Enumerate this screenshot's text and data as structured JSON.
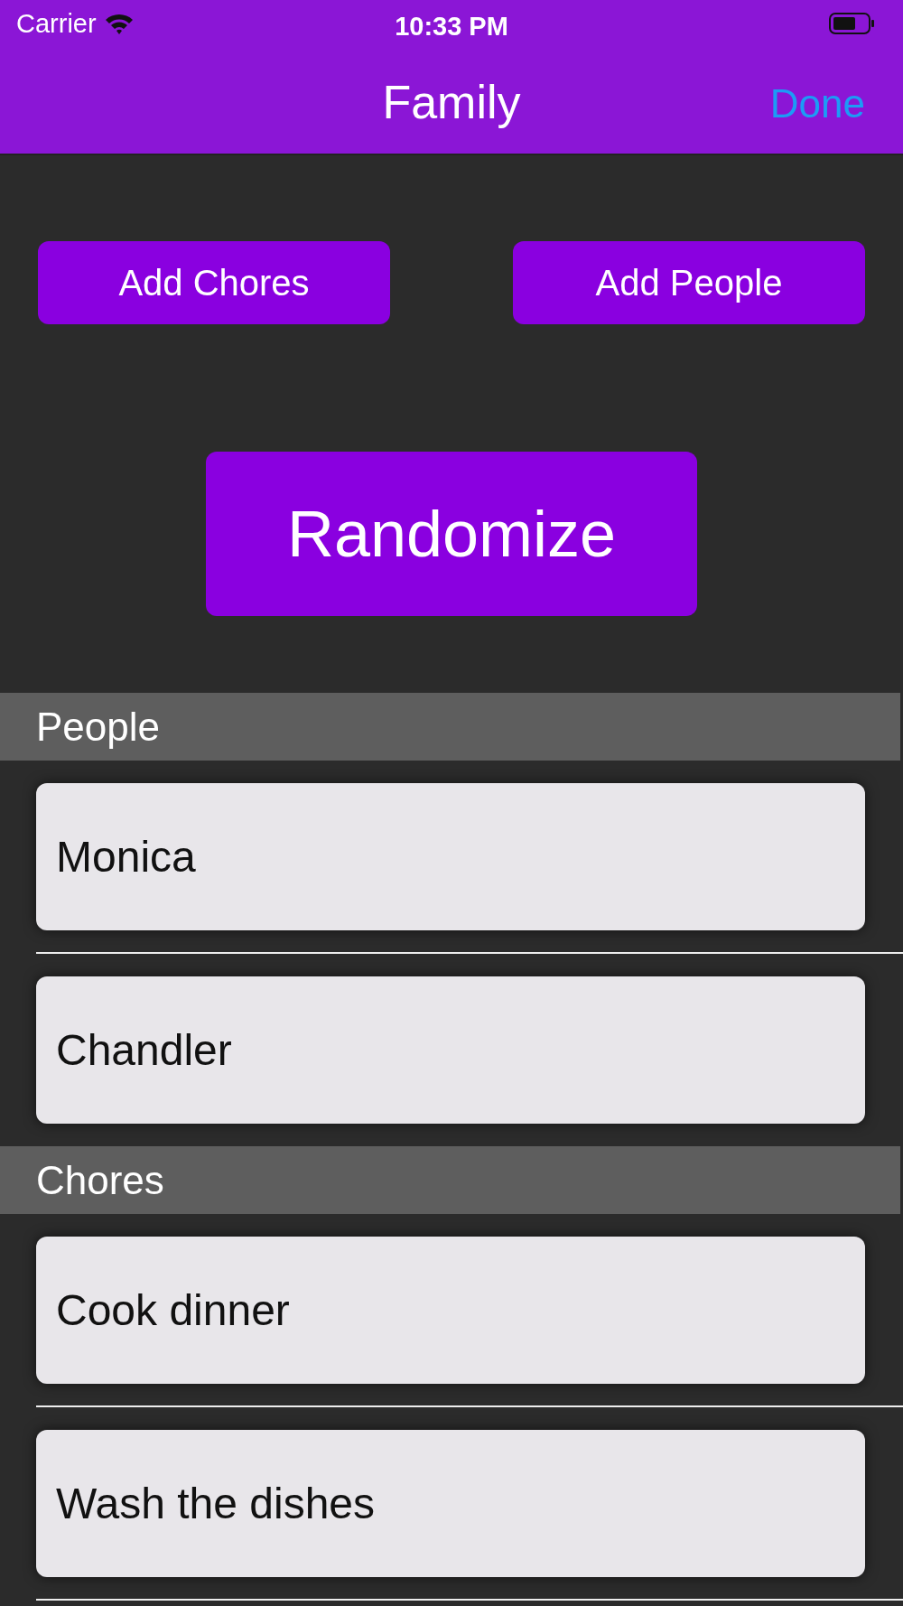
{
  "status_bar": {
    "carrier": "Carrier",
    "time": "10:33 PM"
  },
  "nav": {
    "title": "Family",
    "done": "Done"
  },
  "buttons": [
    "Add Chores",
    "Add People"
  ],
  "primary_button": "Randomize",
  "sections": [
    {
      "title": "People",
      "items": [
        "Monica",
        "Chandler"
      ]
    },
    {
      "title": "Chores",
      "items": [
        "Cook dinner",
        "Wash the dishes"
      ]
    }
  ]
}
